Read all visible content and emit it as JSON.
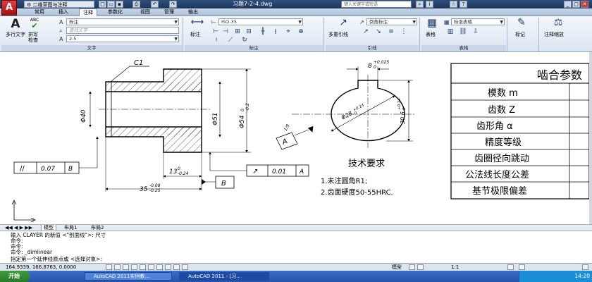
{
  "titlebar": {
    "workspace": "二维草图与注释",
    "title": "习题7-2-4.dwg",
    "search_placeholder": "键入关键字或短语"
  },
  "ribbon_tabs": [
    "常用",
    "插入",
    "注释",
    "参数化",
    "视图",
    "管理",
    "输出"
  ],
  "ribbon": {
    "multiline_text": "多行文字",
    "spell_check": "拼写\n检查",
    "spell_check_l1": "拼写",
    "spell_check_l2": "检查",
    "abc_label": "ABC",
    "text_style": "标注",
    "find_text_placeholder": "查找文字",
    "text_height": "2.5",
    "panel_text": "文字",
    "dimension_button": "标注",
    "dim_style": "ISO-35",
    "panel_dimension": "标注",
    "multileader": "多重引线",
    "leader_style": "倒角标注",
    "panel_leader": "引线",
    "table_button": "表格",
    "table_style": "标准表格",
    "panel_table": "表格",
    "markup_button": "标记",
    "scale_button": "注释缩放"
  },
  "drawing": {
    "c1": "C1",
    "phi40": "Φ40",
    "phi51": "Φ51",
    "phi54": "Φ54",
    "phi54_tol_upper": "0",
    "phi54_tol_lower": "-0.2",
    "tol_frame_left": [
      "//",
      "0.07",
      "B"
    ],
    "tol_frame_right": [
      "↗",
      "0.01",
      "A"
    ],
    "dim13": "13",
    "dim13_upper": "0",
    "dim13_lower": "-0.24",
    "dim35": "35",
    "dim35_upper": "-0.08",
    "dim35_lower": "-0.25",
    "datum_b": "B",
    "datum_a": "A",
    "keyway_width": "8",
    "keyway_width_upper": "+0.025",
    "keyway_width_lower": "0",
    "bore_dia": "Φ28",
    "bore_dia_upper": "+0.14",
    "bore_dia_lower": "0",
    "keyway_depth": "30.6",
    "keyway_depth_upper": "+0.14",
    "keyway_depth_lower": "0",
    "depth_small": "1/9",
    "tech_title": "技术要求",
    "tech_req": [
      "1.未注圆角R1;",
      "2.齿面硬度50-55HRC."
    ]
  },
  "param_table": {
    "title": "啮合参数",
    "rows": [
      "模数    m",
      "齿数    Z",
      "齿形角    α",
      "精度等级",
      "齿圈径向跳动",
      "公法线长度公差",
      "基节极限偏差"
    ]
  },
  "layout_tabs": [
    "模型",
    "布局1",
    "布局2"
  ],
  "command_history": [
    "输入 CLAYER 的新值 <\"剖面线\">: 尺寸",
    "命令:",
    "命令:",
    "命令: _dimlinear",
    "指定第一个延伸线原点或 <选择对象>:"
  ],
  "status": {
    "coords": "164.9339, 166.8763, 0.0000",
    "model_label": "模型",
    "scale": "1:1"
  },
  "taskbar": {
    "start": "开始",
    "items": [
      "AutoCAD 2011实例教...",
      "AutoCAD 2011 - [习..."
    ],
    "clock": "14:20"
  }
}
